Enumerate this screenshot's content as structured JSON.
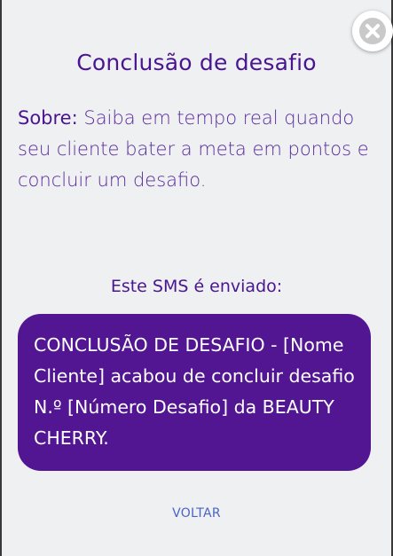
{
  "modal": {
    "title": "Conclusão de desafio",
    "about_label": "Sobre:",
    "about_text": " Saiba em tempo real quando seu cliente bater a meta em pontos e concluir um desafio.",
    "sms_caption": "Este SMS é enviado:",
    "sms_message": "CONCLUSÃO DE DESAFIO - [Nome Cliente] acabou de concluir desafio N.º [Número Desafio] da BEAUTY CHERRY.",
    "back_label": "VOLTAR",
    "close_icon": "close-icon"
  },
  "colors": {
    "primary": "#4a1590",
    "bubble": "#521693",
    "link": "#4a63c8",
    "background": "#eef0f1"
  }
}
